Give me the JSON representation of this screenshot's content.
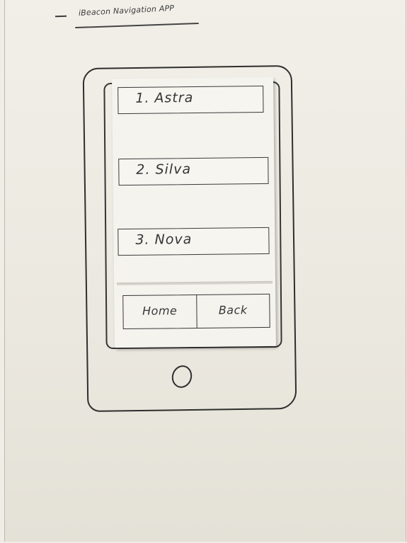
{
  "header": {
    "dash": "—",
    "title": "iBeacon Navigation APP"
  },
  "app": {
    "list_items": [
      {
        "label": "1.  Astra"
      },
      {
        "label": "2.  Silva"
      },
      {
        "label": "3.  Nova"
      }
    ],
    "nav": {
      "home_label": "Home",
      "back_label": "Back"
    }
  }
}
